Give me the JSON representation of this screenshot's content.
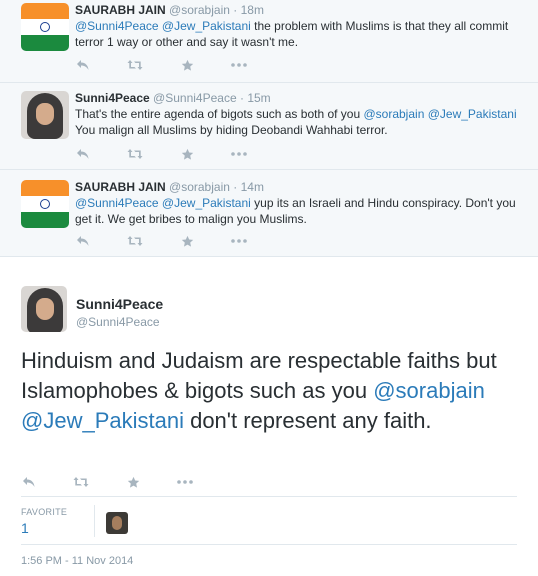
{
  "replies": [
    {
      "name": "SAURABH JAIN",
      "handle": "@sorabjain",
      "time": "18m",
      "avatar_icon": "india-flag-avatar",
      "text": [
        {
          "t": "@Sunni4Peace",
          "m": true
        },
        {
          "t": " ",
          "m": false
        },
        {
          "t": "@Jew_Pakistani",
          "m": true
        },
        {
          "t": " the problem with Muslims is that they all commit terror 1 way or other and say it wasn't me.",
          "m": false
        }
      ]
    },
    {
      "name": "Sunni4Peace",
      "handle": "@Sunni4Peace",
      "time": "15m",
      "avatar_icon": "hijab-portrait-avatar",
      "text": [
        {
          "t": "That's the entire agenda of bigots such as both of you ",
          "m": false
        },
        {
          "t": "@sorabjain",
          "m": true
        },
        {
          "t": " ",
          "m": false
        },
        {
          "t": "@Jew_Pakistani",
          "m": true
        },
        {
          "t": " You malign all Muslims by hiding Deobandi Wahhabi terror.",
          "m": false
        }
      ]
    },
    {
      "name": "SAURABH JAIN",
      "handle": "@sorabjain",
      "time": "14m",
      "avatar_icon": "india-flag-avatar",
      "text": [
        {
          "t": "@Sunni4Peace",
          "m": true
        },
        {
          "t": " ",
          "m": false
        },
        {
          "t": "@Jew_Pakistani",
          "m": true
        },
        {
          "t": " yup its an Israeli and Hindu conspiracy. Don't you get it. We get bribes to malign you Muslims.",
          "m": false
        }
      ]
    }
  ],
  "main": {
    "name": "Sunni4Peace",
    "handle": "@Sunni4Peace",
    "text": [
      {
        "t": "Hinduism and Judaism are respectable faiths but Islamophobes & bigots such as you ",
        "m": false
      },
      {
        "t": "@sorabjain",
        "m": true
      },
      {
        "t": " ",
        "m": false
      },
      {
        "t": "@Jew_Pakistani",
        "m": true
      },
      {
        "t": " don't represent any faith.",
        "m": false
      }
    ],
    "favorite_label": "FAVORITE",
    "favorite_count": "1",
    "timestamp": "1:56 PM - 11 Nov 2014"
  },
  "icons": {
    "reply": "reply-icon",
    "retweet": "retweet-icon",
    "favorite": "star-icon",
    "more": "more-dots-icon"
  },
  "colors": {
    "mention": "#2b7bb9",
    "muted": "#8899a6",
    "reply_bg": "#f5f8fa"
  }
}
